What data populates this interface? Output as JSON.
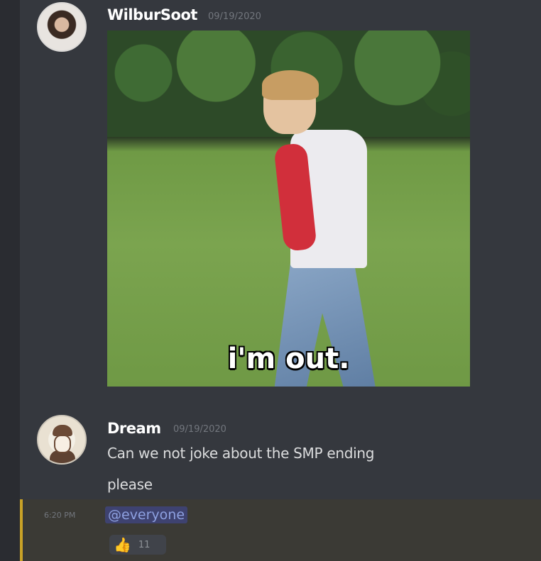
{
  "messages": [
    {
      "username": "WilburSoot",
      "timestamp": "09/19/2020",
      "caption": "i'm out."
    },
    {
      "username": "Dream",
      "timestamp": "09/19/2020",
      "line1": "Can we not joke about the SMP ending",
      "line2": "please"
    },
    {
      "hover_time": "6:20 PM",
      "mention": "@everyone",
      "reaction_count": "11"
    }
  ],
  "icons": {
    "reaction_emoji": "thumbs-up-icon"
  },
  "colors": {
    "background": "#35383e",
    "mention_bg": "#3e4270",
    "mention_text": "#8ea1e1",
    "highlight_bar": "#c9a227"
  }
}
